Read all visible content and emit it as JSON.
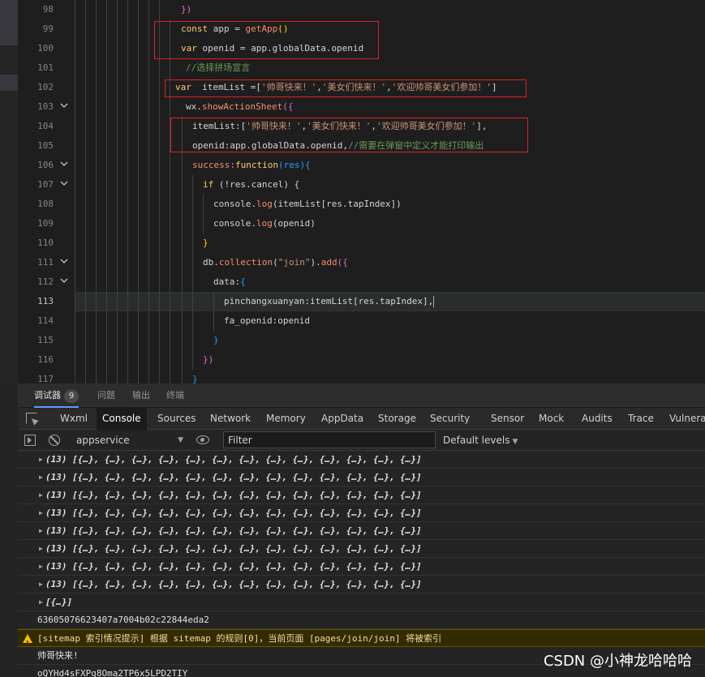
{
  "editor": {
    "line_numbers": [
      "98",
      "99",
      "100",
      "101",
      "102",
      "103",
      "104",
      "105",
      "106",
      "107",
      "108",
      "109",
      "110",
      "111",
      "112",
      "113",
      "114",
      "115",
      "116",
      "117"
    ],
    "current_line": "113",
    "lines": {
      "l98": "})",
      "l99_kw": "const",
      "l99_var": " app = ",
      "l99_fn": "getApp",
      "l99_end": "()",
      "l100_kw": "var",
      "l100_rest": " openid = app.globalData.openid",
      "l101": "//选择拼场宣言",
      "l102_kw": "var",
      "l102_var": "  itemList =[",
      "l102_s1": "'帅哥快来！'",
      "l102_c1": ",",
      "l102_s2": "'美女们快来！'",
      "l102_c2": ",",
      "l102_s3": "'欢迎帅哥美女们参加！'",
      "l102_end": "]",
      "l103_obj": "wx.",
      "l103_fn": "showActionSheet",
      "l103_end": "({",
      "l104_key": "itemList:[",
      "l104_s1": "'帅哥快来！'",
      "l104_c1": ",",
      "l104_s2": "'美女们快来！'",
      "l104_c2": ",",
      "l104_s3": "'欢迎帅哥美女们参加！'",
      "l104_end": "],",
      "l105_code": "openid:app.globalData.openid,",
      "l105_cm": "//需要在弹窗中定义才能打印输出",
      "l106_key": "success:",
      "l106_kw": "function",
      "l106_end": "(res){",
      "l107_kw": "if",
      "l107_rest": " (!res.cancel) {",
      "l108_obj": "console.",
      "l108_fn": "log",
      "l108_rest": "(itemList[res.tapIndex])",
      "l109_obj": "console.",
      "l109_fn": "log",
      "l109_rest": "(openid)",
      "l110": "}",
      "l111_obj": "db.",
      "l111_fn": "collection",
      "l111_p1": "(",
      "l111_str": "\"join\"",
      "l111_p2": ").",
      "l111_fn2": "add",
      "l111_end": "({",
      "l112_key": "data:",
      "l112_brace": "{",
      "l113": "pinchangxuanyan:itemList[res.tapIndex],",
      "l114": "fa_openid:openid",
      "l115": "}",
      "l116": "})",
      "l117": "}"
    }
  },
  "devtools": {
    "top_tabs": [
      {
        "label": "调试器",
        "badge": "9",
        "active": true
      },
      {
        "label": "问题"
      },
      {
        "label": "输出"
      },
      {
        "label": "终端"
      }
    ],
    "panel_tabs": [
      "Wxml",
      "Console",
      "Sources",
      "Network",
      "Memory",
      "AppData",
      "Storage",
      "Security",
      "Sensor",
      "Mock",
      "Audits",
      "Trace",
      "Vulnerab"
    ],
    "active_panel": "Console",
    "toolbar": {
      "context": "appservice",
      "filter_placeholder": "Filter",
      "levels": "Default levels"
    },
    "log": {
      "array_row": "(13) [{…}, {…}, {…}, {…}, {…}, {…}, {…}, {…}, {…}, {…}, {…}, {…}, {…}]",
      "array_row_count": 8,
      "single_row": "[{…}]",
      "openid_line": "63605076623407a7004b02c22844eda2",
      "warning": "[sitemap 索引情况提示] 根据 sitemap 的规则[0]，当前页面 [pages/join/join] 将被索引",
      "output_line": "帅哥快来!",
      "last_line": "oQYHd4sFXPg8Oma2TP6x5LPD2TIY"
    }
  },
  "watermark": "CSDN @小神龙哈哈哈",
  "colors": {
    "annotation_box": "#e02020",
    "active_tab_underline": "#5b9aff",
    "warning_bg": "#332b00"
  }
}
